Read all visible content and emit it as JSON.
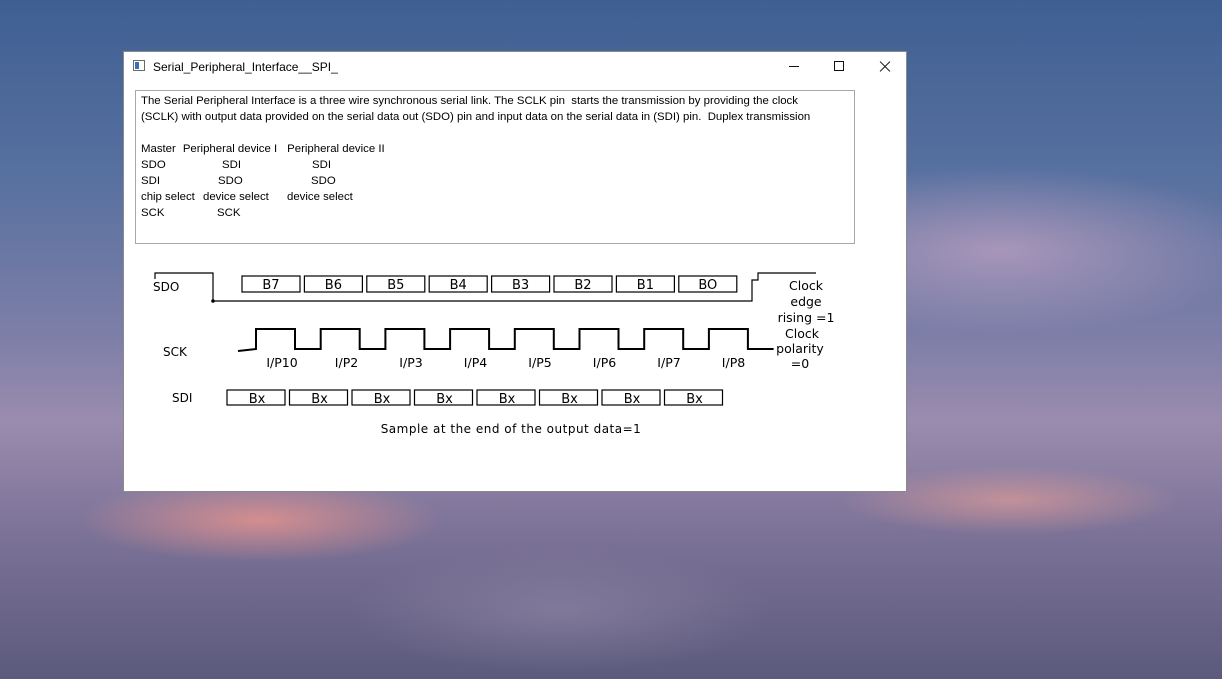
{
  "window": {
    "title": "Serial_Peripheral_Interface__SPI_",
    "controls": {
      "minimize": "minimize",
      "maximize": "maximize",
      "close": "close"
    }
  },
  "description": {
    "paragraph_lines": [
      "The Serial Peripheral Interface is a three wire synchronous serial link. The SCLK pin  starts the transmission by providing the clock",
      "(SCLK) with output data provided on the serial data out (SDO) pin and input data on the serial data in (SDI) pin.  Duplex transmission"
    ],
    "table": {
      "headers": [
        "Master",
        "Peripheral device I",
        "Peripheral device II"
      ],
      "rows": [
        [
          "SDO",
          "SDI",
          "SDI"
        ],
        [
          "SDI",
          "SDO",
          "SDO"
        ],
        [
          "chip select",
          "device select",
          "device select"
        ],
        [
          "SCK",
          "SCK",
          ""
        ]
      ]
    }
  },
  "diagram": {
    "sdo_label": "SDO",
    "sck_label": "SCK",
    "sdi_label": "SDI",
    "sdo_bits": [
      "B7",
      "B6",
      "B5",
      "B4",
      "B3",
      "B2",
      "B1",
      "BO"
    ],
    "sdi_bits": [
      "Bx",
      "Bx",
      "Bx",
      "Bx",
      "Bx",
      "Bx",
      "Bx",
      "Bx"
    ],
    "pulse_labels": [
      "I/P10",
      "I/P2",
      "I/P3",
      "I/P4",
      "I/P5",
      "I/P6",
      "I/P7",
      "I/P8"
    ],
    "clock_edge_lines": [
      "Clock",
      "edge",
      "rising =1"
    ],
    "clock_polarity_lines": [
      "Clock",
      "polarity",
      "=0"
    ],
    "caption": "Sample at the end of the output data=1"
  }
}
